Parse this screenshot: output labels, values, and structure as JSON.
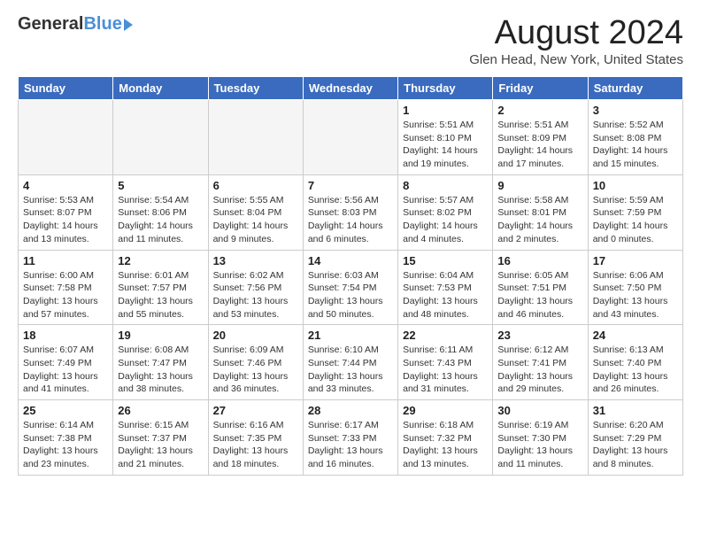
{
  "header": {
    "logo_general": "General",
    "logo_blue": "Blue",
    "month_title": "August 2024",
    "location": "Glen Head, New York, United States"
  },
  "weekdays": [
    "Sunday",
    "Monday",
    "Tuesday",
    "Wednesday",
    "Thursday",
    "Friday",
    "Saturday"
  ],
  "weeks": [
    [
      {
        "day": "",
        "info": ""
      },
      {
        "day": "",
        "info": ""
      },
      {
        "day": "",
        "info": ""
      },
      {
        "day": "",
        "info": ""
      },
      {
        "day": "1",
        "info": "Sunrise: 5:51 AM\nSunset: 8:10 PM\nDaylight: 14 hours\nand 19 minutes."
      },
      {
        "day": "2",
        "info": "Sunrise: 5:51 AM\nSunset: 8:09 PM\nDaylight: 14 hours\nand 17 minutes."
      },
      {
        "day": "3",
        "info": "Sunrise: 5:52 AM\nSunset: 8:08 PM\nDaylight: 14 hours\nand 15 minutes."
      }
    ],
    [
      {
        "day": "4",
        "info": "Sunrise: 5:53 AM\nSunset: 8:07 PM\nDaylight: 14 hours\nand 13 minutes."
      },
      {
        "day": "5",
        "info": "Sunrise: 5:54 AM\nSunset: 8:06 PM\nDaylight: 14 hours\nand 11 minutes."
      },
      {
        "day": "6",
        "info": "Sunrise: 5:55 AM\nSunset: 8:04 PM\nDaylight: 14 hours\nand 9 minutes."
      },
      {
        "day": "7",
        "info": "Sunrise: 5:56 AM\nSunset: 8:03 PM\nDaylight: 14 hours\nand 6 minutes."
      },
      {
        "day": "8",
        "info": "Sunrise: 5:57 AM\nSunset: 8:02 PM\nDaylight: 14 hours\nand 4 minutes."
      },
      {
        "day": "9",
        "info": "Sunrise: 5:58 AM\nSunset: 8:01 PM\nDaylight: 14 hours\nand 2 minutes."
      },
      {
        "day": "10",
        "info": "Sunrise: 5:59 AM\nSunset: 7:59 PM\nDaylight: 14 hours\nand 0 minutes."
      }
    ],
    [
      {
        "day": "11",
        "info": "Sunrise: 6:00 AM\nSunset: 7:58 PM\nDaylight: 13 hours\nand 57 minutes."
      },
      {
        "day": "12",
        "info": "Sunrise: 6:01 AM\nSunset: 7:57 PM\nDaylight: 13 hours\nand 55 minutes."
      },
      {
        "day": "13",
        "info": "Sunrise: 6:02 AM\nSunset: 7:56 PM\nDaylight: 13 hours\nand 53 minutes."
      },
      {
        "day": "14",
        "info": "Sunrise: 6:03 AM\nSunset: 7:54 PM\nDaylight: 13 hours\nand 50 minutes."
      },
      {
        "day": "15",
        "info": "Sunrise: 6:04 AM\nSunset: 7:53 PM\nDaylight: 13 hours\nand 48 minutes."
      },
      {
        "day": "16",
        "info": "Sunrise: 6:05 AM\nSunset: 7:51 PM\nDaylight: 13 hours\nand 46 minutes."
      },
      {
        "day": "17",
        "info": "Sunrise: 6:06 AM\nSunset: 7:50 PM\nDaylight: 13 hours\nand 43 minutes."
      }
    ],
    [
      {
        "day": "18",
        "info": "Sunrise: 6:07 AM\nSunset: 7:49 PM\nDaylight: 13 hours\nand 41 minutes."
      },
      {
        "day": "19",
        "info": "Sunrise: 6:08 AM\nSunset: 7:47 PM\nDaylight: 13 hours\nand 38 minutes."
      },
      {
        "day": "20",
        "info": "Sunrise: 6:09 AM\nSunset: 7:46 PM\nDaylight: 13 hours\nand 36 minutes."
      },
      {
        "day": "21",
        "info": "Sunrise: 6:10 AM\nSunset: 7:44 PM\nDaylight: 13 hours\nand 33 minutes."
      },
      {
        "day": "22",
        "info": "Sunrise: 6:11 AM\nSunset: 7:43 PM\nDaylight: 13 hours\nand 31 minutes."
      },
      {
        "day": "23",
        "info": "Sunrise: 6:12 AM\nSunset: 7:41 PM\nDaylight: 13 hours\nand 29 minutes."
      },
      {
        "day": "24",
        "info": "Sunrise: 6:13 AM\nSunset: 7:40 PM\nDaylight: 13 hours\nand 26 minutes."
      }
    ],
    [
      {
        "day": "25",
        "info": "Sunrise: 6:14 AM\nSunset: 7:38 PM\nDaylight: 13 hours\nand 23 minutes."
      },
      {
        "day": "26",
        "info": "Sunrise: 6:15 AM\nSunset: 7:37 PM\nDaylight: 13 hours\nand 21 minutes."
      },
      {
        "day": "27",
        "info": "Sunrise: 6:16 AM\nSunset: 7:35 PM\nDaylight: 13 hours\nand 18 minutes."
      },
      {
        "day": "28",
        "info": "Sunrise: 6:17 AM\nSunset: 7:33 PM\nDaylight: 13 hours\nand 16 minutes."
      },
      {
        "day": "29",
        "info": "Sunrise: 6:18 AM\nSunset: 7:32 PM\nDaylight: 13 hours\nand 13 minutes."
      },
      {
        "day": "30",
        "info": "Sunrise: 6:19 AM\nSunset: 7:30 PM\nDaylight: 13 hours\nand 11 minutes."
      },
      {
        "day": "31",
        "info": "Sunrise: 6:20 AM\nSunset: 7:29 PM\nDaylight: 13 hours\nand 8 minutes."
      }
    ]
  ]
}
